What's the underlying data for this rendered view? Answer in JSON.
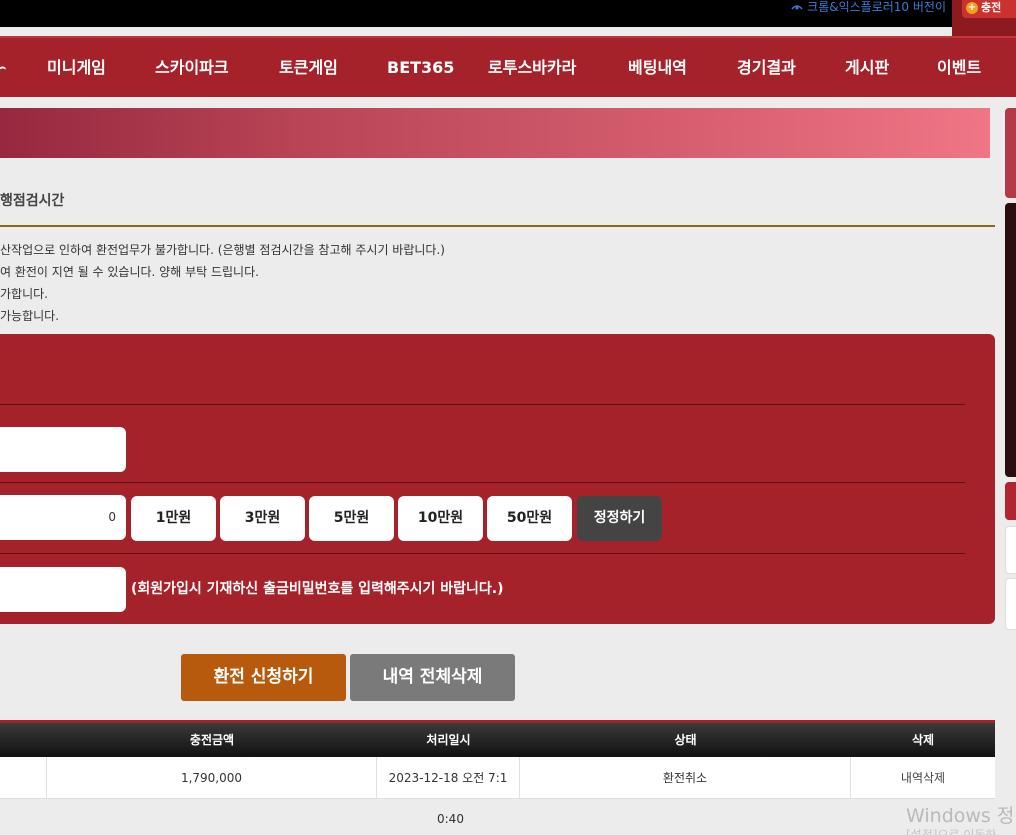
{
  "topbar": {
    "browser_notice": "크롬&익스플로러10 버전이",
    "charge_button": "충전"
  },
  "nav": {
    "items": [
      {
        "label": "∽"
      },
      {
        "label": "미니게임"
      },
      {
        "label": "스카이파크"
      },
      {
        "label": "토큰게임"
      },
      {
        "label": "BET365"
      },
      {
        "label": "로투스바카라"
      },
      {
        "label": "베팅내역"
      },
      {
        "label": "경기결과"
      },
      {
        "label": "게시판"
      },
      {
        "label": "이벤트"
      }
    ]
  },
  "section": {
    "title": "행점검시간"
  },
  "notes": [
    "산작업으로 인하여 환전업무가 불가합니다. (은행별 점검시간을 참고해 주시기 바랍니다.)",
    "여 환전이 지연 될 수 있습니다. 양해 부탁 드립니다.",
    "가합니다.",
    "가능합니다."
  ],
  "form": {
    "amount_value": "0",
    "quick_amounts": [
      "1만원",
      "3만원",
      "5만원",
      "10만원",
      "50만원"
    ],
    "reset_label": "정정하기",
    "password_note": "(회원가입시 기재하신 출금비밀번호를 입력해주시기 바랍니다.)"
  },
  "actions": {
    "submit_label": "환전 신청하기",
    "delete_all_label": "내역 전체삭제"
  },
  "table": {
    "headers": [
      "충전금액",
      "처리일시",
      "상태",
      "삭제"
    ],
    "rows": [
      {
        "amount": "1,790,000",
        "datetime": "2023-12-18 오전 7:1",
        "datetime_overflow": "0:40",
        "status": "환전취소",
        "delete": "내역삭제"
      }
    ]
  },
  "watermark": {
    "line1": "Windows 정",
    "line2": "[설정]으로 이동하"
  },
  "colors": {
    "nav_bg": "#a5222a",
    "form_bg": "#a5222a",
    "submit_bg": "#b85a0d",
    "delete_bg": "#7a7a7a",
    "gold_line": "#8b6a14"
  }
}
